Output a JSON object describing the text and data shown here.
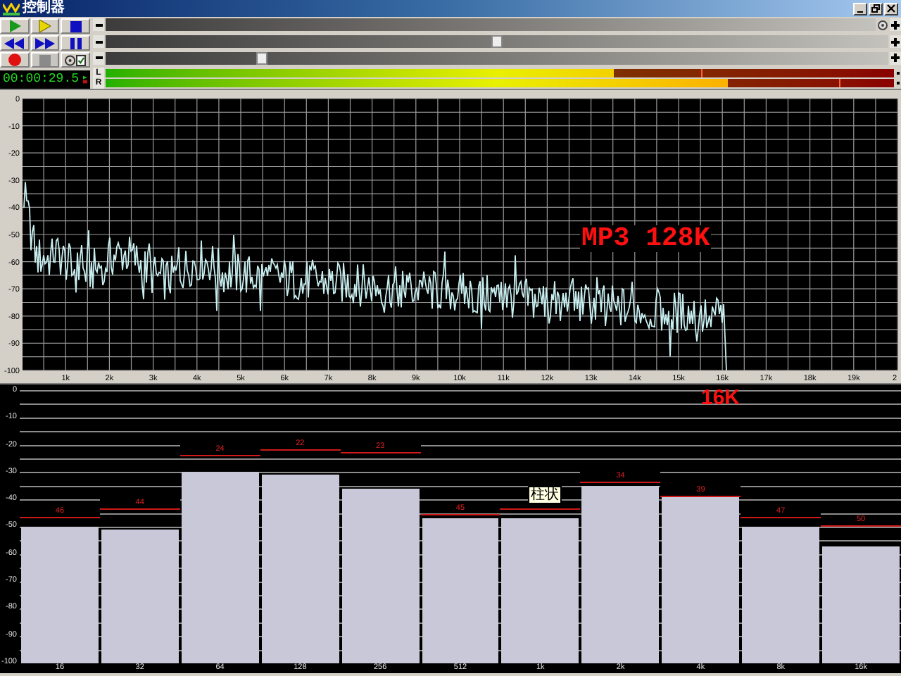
{
  "window": {
    "title": "控制器"
  },
  "transport_buttons": [
    {
      "kind": "play",
      "disabled": false
    },
    {
      "kind": "play-selection",
      "disabled": false
    },
    {
      "kind": "stop",
      "disabled": false
    },
    {
      "kind": "rewind",
      "disabled": false
    },
    {
      "kind": "forward",
      "disabled": false
    },
    {
      "kind": "pause",
      "disabled": false
    },
    {
      "kind": "record",
      "disabled": false
    },
    {
      "kind": "stop",
      "disabled": true
    },
    {
      "kind": "loop",
      "disabled": false
    }
  ],
  "time_display": {
    "value": "00:00:29.5"
  },
  "sliders": [
    {
      "kind": "settings"
    },
    {
      "kind": "plain",
      "level": 0.5
    },
    {
      "kind": "plain",
      "level": 0.2
    }
  ],
  "meter": {
    "channels": [
      {
        "label": "L",
        "level": 0.645,
        "peak": {
          "level": 0.755
        }
      },
      {
        "label": "R",
        "level": 0.79,
        "peak": {
          "level": 0.93
        }
      }
    ]
  },
  "spectrum": {
    "overlay_text": "MP3 128K",
    "y_labels": [
      "0",
      "-10",
      "-20",
      "-30",
      "-40",
      "-50",
      "-60",
      "-70",
      "-80",
      "-90",
      "-100"
    ],
    "x_labels": [
      "1k",
      "2k",
      "3k",
      "4k",
      "5k",
      "6k",
      "7k",
      "8k",
      "9k",
      "10k",
      "11k",
      "12k",
      "13k",
      "14k",
      "15k",
      "16k",
      "17k",
      "18k",
      "19k",
      "2"
    ]
  },
  "bar_chart": {
    "overlay_text": "16K",
    "tooltip": "柱状",
    "y_labels": [
      "0",
      "-10",
      "-20",
      "-30",
      "-40",
      "-50",
      "-60",
      "-70",
      "-80",
      "-90",
      "-100"
    ],
    "bands": [
      {
        "label": "16",
        "level": 0.5,
        "peak": {
          "level": 0.53,
          "label": "46"
        }
      },
      {
        "label": "32",
        "level": 0.49,
        "peak": {
          "level": 0.56,
          "label": "44"
        }
      },
      {
        "label": "64",
        "level": 0.7,
        "peak": {
          "level": 0.76,
          "label": "24"
        }
      },
      {
        "label": "128",
        "level": 0.69,
        "peak": {
          "level": 0.78,
          "label": "22"
        }
      },
      {
        "label": "256",
        "level": 0.64,
        "peak": {
          "level": 0.77,
          "label": "23"
        }
      },
      {
        "label": "512",
        "level": 0.53,
        "peak": {
          "level": 0.54,
          "label": "45"
        }
      },
      {
        "label": "1k",
        "level": 0.53,
        "peak": {
          "level": 0.56
        }
      },
      {
        "label": "2k",
        "level": 0.65,
        "peak": {
          "level": 0.66,
          "label": "34"
        }
      },
      {
        "label": "4k",
        "level": 0.61,
        "peak": {
          "level": 0.61,
          "label": "39"
        }
      },
      {
        "label": "8k",
        "level": 0.5,
        "peak": {
          "level": 0.53,
          "label": "47"
        }
      },
      {
        "label": "16k",
        "level": 0.43,
        "peak": {
          "level": 0.5,
          "label": "50"
        }
      }
    ]
  }
}
